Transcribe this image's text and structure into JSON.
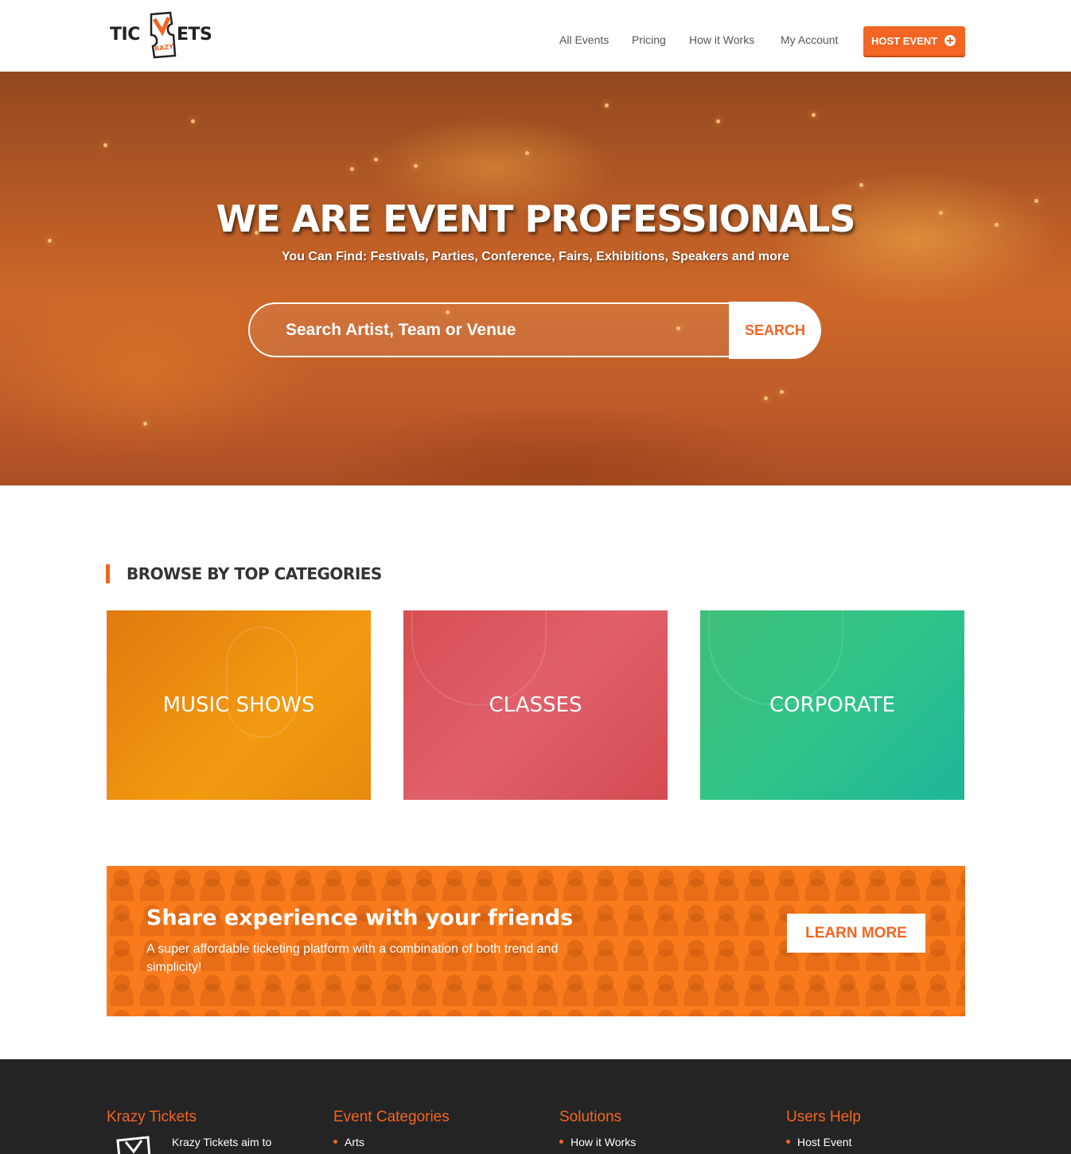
{
  "brand": {
    "logo_left": "TIC",
    "logo_right": "ETS",
    "logo_badge": "RAZY",
    "accent": "#f26522"
  },
  "nav": {
    "items": [
      {
        "label": "All Events"
      },
      {
        "label": "Pricing"
      },
      {
        "label": "How it Works"
      },
      {
        "label": "My Account"
      }
    ],
    "host_event": "HOST EVENT",
    "host_event_icon": "plus-circle-icon"
  },
  "hero": {
    "title": "WE ARE EVENT PROFESSIONALS",
    "subtitle": "You Can Find: Festivals, Parties, Conference, Fairs, Exhibitions, Speakers and more",
    "search_placeholder": "Search Artist, Team or Venue",
    "search_button": "SEARCH"
  },
  "categories": {
    "heading": "BROWSE BY TOP CATEGORIES",
    "items": [
      {
        "label": "MUSIC SHOWS",
        "color": "#f08c10"
      },
      {
        "label": "CLASSES",
        "color": "#dc5a60"
      },
      {
        "label": "CORPORATE",
        "color": "#30c489"
      }
    ]
  },
  "cta": {
    "title": "Share experience with your friends",
    "text": "A super affordable ticketing platform with a combination of both trend and simplicity!",
    "button": "LEARN MORE",
    "color": "#f97b1c"
  },
  "footer": {
    "background": "#242424",
    "columns": [
      {
        "heading": "Krazy Tickets",
        "item": "Krazy Tickets aim to"
      },
      {
        "heading": "Event Categories",
        "item": "Arts"
      },
      {
        "heading": "Solutions",
        "item": "How it Works"
      },
      {
        "heading": "Users Help",
        "item": "Host Event"
      }
    ]
  }
}
